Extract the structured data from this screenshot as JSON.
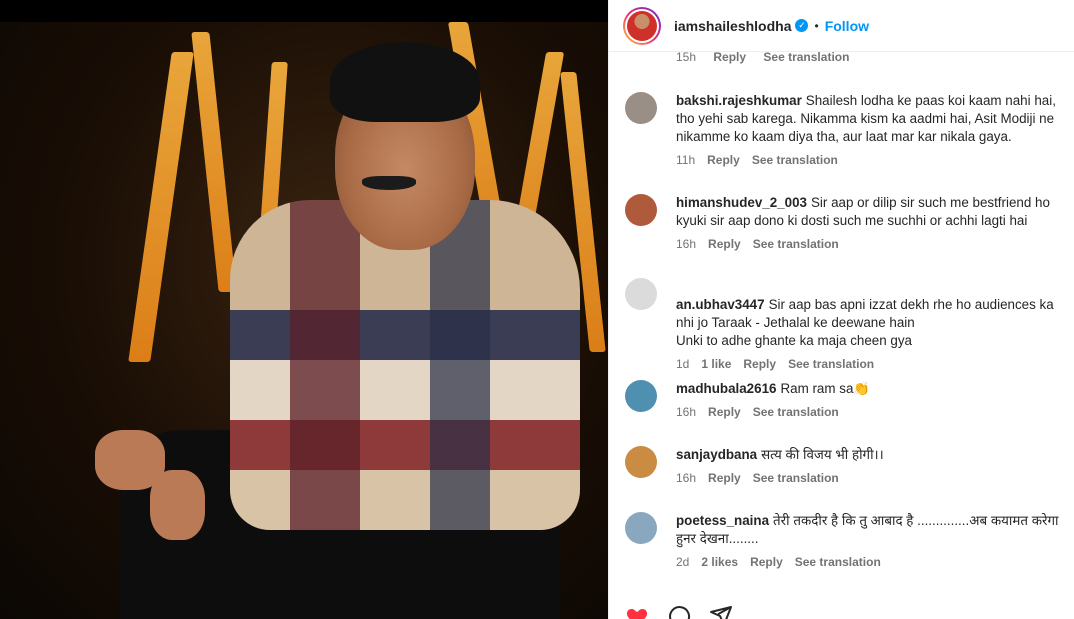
{
  "header": {
    "username": "iamshaileshlodha",
    "follow_label": "Follow",
    "dot": "•",
    "verified_glyph": "✓"
  },
  "previous_meta": {
    "time": "15h",
    "reply": "Reply",
    "translation": "See translation"
  },
  "comments": [
    {
      "username": "bakshi.rajeshkumar",
      "text": "Shailesh lodha ke paas koi kaam nahi hai, tho yehi sab karega. Nikamma kism ka aadmi hai, Asit Modiji ne nikamme ko kaam diya tha, aur laat mar kar nikala gaya.",
      "time": "11h",
      "likes": "",
      "reply": "Reply",
      "translation": "See translation",
      "avatar_color": "#9a8f86"
    },
    {
      "username": "himanshudev_2_003",
      "text": "Sir aap or dilip sir such me bestfriend ho kyuki sir aap dono ki dosti such me suchhi or achhi lagti hai",
      "time": "16h",
      "likes": "",
      "reply": "Reply",
      "translation": "See translation",
      "avatar_color": "#b05a3c"
    },
    {
      "username": "an.ubhav3447",
      "text": "Sir aap bas apni izzat dekh rhe ho audiences ka nhi jo Taraak - Jethalal ke deewane hain\nUnki to adhe ghante ka maja cheen gya",
      "time": "1d",
      "likes": "1 like",
      "reply": "Reply",
      "translation": "See translation",
      "avatar_color": "#dbdbdb"
    },
    {
      "username": "madhubala2616",
      "text": "Ram ram sa👏",
      "time": "16h",
      "likes": "",
      "reply": "Reply",
      "translation": "See translation",
      "avatar_color": "#4f8fb0"
    },
    {
      "username": "sanjaydbana",
      "text": "सत्य की विजय भी होगी।।",
      "time": "16h",
      "likes": "",
      "reply": "Reply",
      "translation": "See translation",
      "avatar_color": "#c98c42"
    },
    {
      "username": "poetess_naina",
      "text": "तेरी तकदीर है कि तु आबाद है ..............अब कयामत करेगा हुनर देखना........",
      "time": "2d",
      "likes": "2 likes",
      "reply": "Reply",
      "translation": "See translation",
      "avatar_color": "#8aa7c0"
    }
  ],
  "actions": {
    "like_icon": "heart-icon",
    "comment_icon": "comment-icon",
    "share_icon": "share-icon"
  },
  "colors": {
    "link_blue": "#0095f6",
    "like_red": "#ff3040",
    "meta_gray": "#737373"
  }
}
